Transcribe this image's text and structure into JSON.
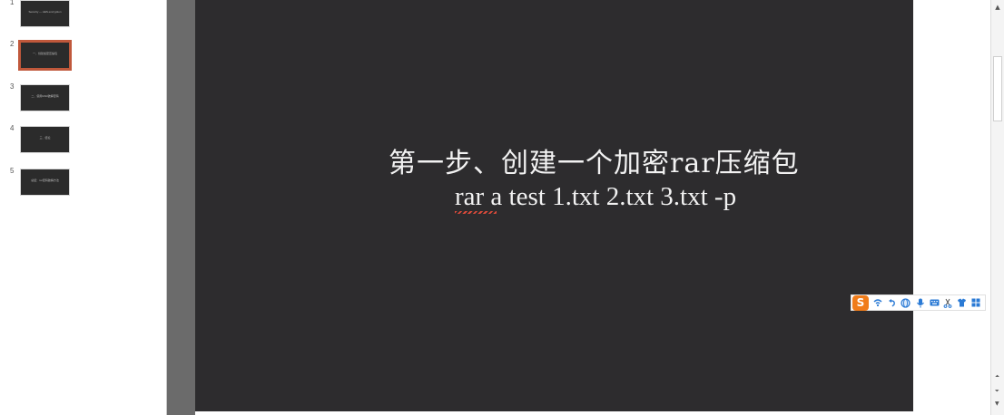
{
  "thumbnails": [
    {
      "number": "1",
      "caption": "Security — AES encryption",
      "selected": false
    },
    {
      "number": "2",
      "caption": "一、创建加密压缩包",
      "selected": true
    },
    {
      "number": "3",
      "caption": "二、使用RAR破解密码",
      "selected": false
    },
    {
      "number": "4",
      "caption": "三、结论",
      "selected": false
    },
    {
      "number": "5",
      "caption": "总结：rar密码破解方法",
      "selected": false
    }
  ],
  "slide": {
    "title": "第一步、创建一个加密rar压缩包",
    "command": "rar a test 1.txt 2.txt 3.txt -p",
    "spellcheck_word": "rar"
  },
  "ime_toolbar": {
    "logo": "S",
    "icons": [
      "wifi-icon",
      "undo-icon",
      "globe-icon",
      "microphone-icon",
      "keyboard-icon",
      "scissors-icon",
      "shirt-icon",
      "grid-icon"
    ]
  },
  "scrollbar": {
    "up": "▲",
    "prev": "⏶",
    "next": "⏷",
    "down": "▼"
  },
  "colors": {
    "slide_background": "#2d2c2e",
    "selected_thumbnail_border": "#c0583b",
    "ime_logo": "#f07c1a"
  }
}
